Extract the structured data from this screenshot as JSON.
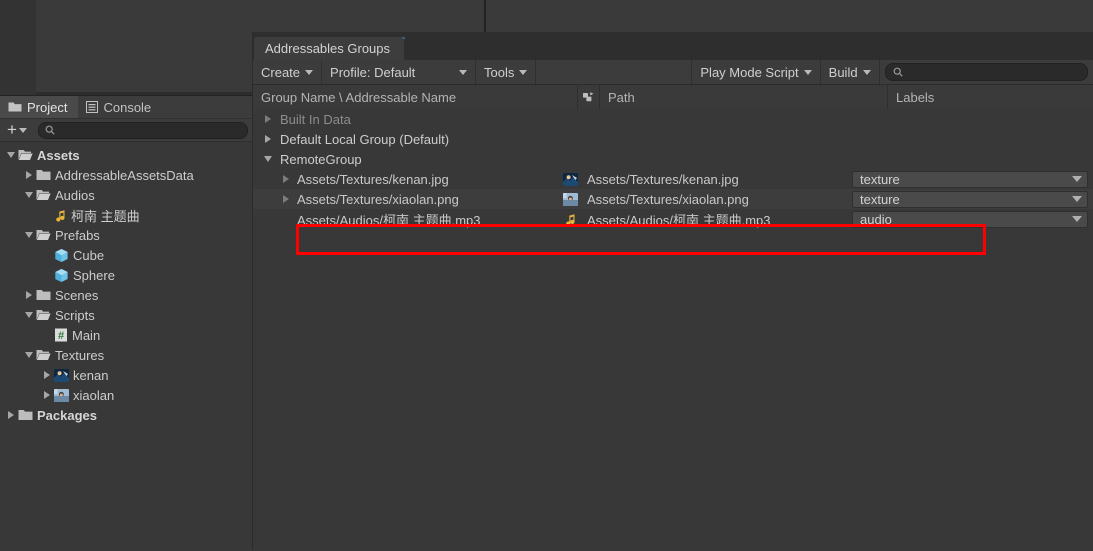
{
  "window": {
    "tab_label": "Addressables Groups",
    "accent_color": "#2f7ec0"
  },
  "toolbar": {
    "create_label": "Create",
    "profile_label": "Profile: Default",
    "tools_label": "Tools",
    "play_mode_label": "Play Mode Script",
    "build_label": "Build",
    "search_placeholder": "",
    "search_value": "",
    "search_icon": "search-icon"
  },
  "columns": {
    "group_name": "Group Name \\ Addressable Name",
    "flag_icon": "addressable-flag-icon",
    "path": "Path",
    "labels": "Labels"
  },
  "groups": [
    {
      "name": "Built In Data",
      "expanded": false,
      "dim": true
    },
    {
      "name": "Default Local Group (Default)",
      "expanded": false,
      "dim": false
    },
    {
      "name": "RemoteGroup",
      "expanded": true,
      "dim": false
    }
  ],
  "assets": [
    {
      "name": "Assets/Textures/kenan.jpg",
      "icon": "texture-thumbnail-kenan",
      "path": "Assets/Textures/kenan.jpg",
      "label": "texture",
      "has_foldout": true,
      "highlighted": false
    },
    {
      "name": "Assets/Textures/xiaolan.png",
      "icon": "texture-thumbnail-xiaolan",
      "path": "Assets/Textures/xiaolan.png",
      "label": "texture",
      "has_foldout": true,
      "highlighted": false
    },
    {
      "name": "Assets/Audios/柯南 主题曲.mp3",
      "icon": "audio-clip-icon",
      "path": "Assets/Audios/柯南 主题曲.mp3",
      "label": "audio",
      "has_foldout": false,
      "highlighted": true
    }
  ],
  "annotations": {
    "highlight_color": "#ff0000",
    "row_box": "red-highlight-asset-row",
    "label_box": "red-highlight-label-field"
  },
  "project_panel": {
    "tabs": [
      {
        "label": "Project",
        "icon": "folder-icon",
        "active": true
      },
      {
        "label": "Console",
        "icon": "console-icon",
        "active": false
      }
    ],
    "toolbar": {
      "add_label": "+",
      "search_placeholder": "",
      "search_value": "",
      "search_icon": "search-icon"
    },
    "tree": [
      {
        "label": "Assets",
        "icon": "folder-open-icon",
        "depth": 0,
        "state": "expanded",
        "bold": true
      },
      {
        "label": "AddressableAssetsData",
        "icon": "folder-icon",
        "depth": 1,
        "state": "collapsed",
        "bold": false
      },
      {
        "label": "Audios",
        "icon": "folder-open-icon",
        "depth": 1,
        "state": "expanded",
        "bold": false
      },
      {
        "label": "柯南 主题曲",
        "icon": "audio-clip-icon",
        "depth": 2,
        "state": "leaf",
        "bold": false
      },
      {
        "label": "Prefabs",
        "icon": "folder-open-icon",
        "depth": 1,
        "state": "expanded",
        "bold": false
      },
      {
        "label": "Cube",
        "icon": "prefab-cube-icon",
        "depth": 2,
        "state": "leaf",
        "bold": false
      },
      {
        "label": "Sphere",
        "icon": "prefab-cube-icon",
        "depth": 2,
        "state": "leaf",
        "bold": false
      },
      {
        "label": "Scenes",
        "icon": "folder-icon",
        "depth": 1,
        "state": "collapsed",
        "bold": false
      },
      {
        "label": "Scripts",
        "icon": "folder-open-icon",
        "depth": 1,
        "state": "expanded",
        "bold": false
      },
      {
        "label": "Main",
        "icon": "csharp-script-icon",
        "depth": 2,
        "state": "leaf",
        "bold": false
      },
      {
        "label": "Textures",
        "icon": "folder-open-icon",
        "depth": 1,
        "state": "expanded",
        "bold": false
      },
      {
        "label": "kenan",
        "icon": "texture-thumbnail-kenan",
        "depth": 2,
        "state": "collapsed",
        "bold": false
      },
      {
        "label": "xiaolan",
        "icon": "texture-thumbnail-xiaolan",
        "depth": 2,
        "state": "collapsed",
        "bold": false
      },
      {
        "label": "Packages",
        "icon": "folder-icon",
        "depth": 0,
        "state": "collapsed",
        "bold": true
      }
    ]
  }
}
